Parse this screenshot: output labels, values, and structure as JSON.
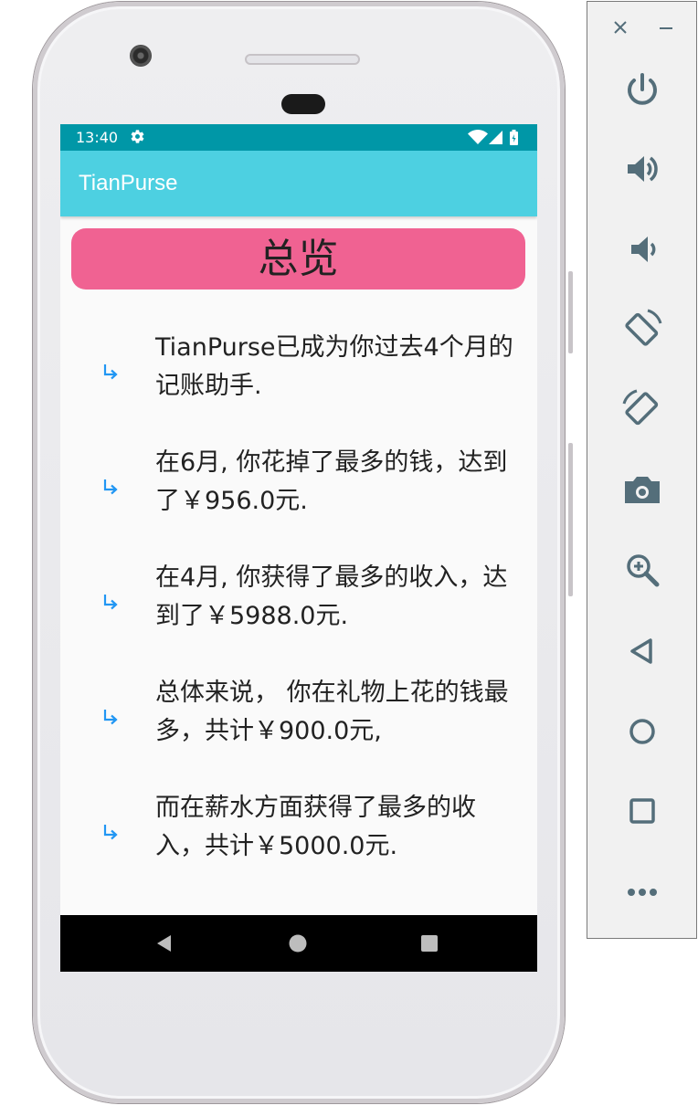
{
  "status_bar": {
    "time": "13:40"
  },
  "app_bar": {
    "title": "TianPurse"
  },
  "header": {
    "title": "总览"
  },
  "items": [
    {
      "text": "TianPurse已成为你过去4个月的记账助手."
    },
    {
      "text": "在6月, 你花掉了最多的钱，达到了￥956.0元."
    },
    {
      "text": "在4月, 你获得了最多的收入，达到了￥5988.0元."
    },
    {
      "text": "总体来说， 你在礼物上花的钱最多，共计￥900.0元,"
    },
    {
      "text": "而在薪水方面获得了最多的收入，共计￥5000.0元."
    }
  ],
  "colors": {
    "status_bar": "#0097a7",
    "app_bar": "#4dd0e1",
    "header_pill": "#f06292",
    "arrow": "#2196f3",
    "toolbar_icon": "#546e7a"
  },
  "icons": {
    "status": [
      "gear-icon",
      "wifi-icon",
      "signal-icon",
      "battery-icon"
    ],
    "list_bullet": "arrow-down-right-icon",
    "nav": [
      "back-icon",
      "home-icon",
      "recents-icon"
    ],
    "toolbar": [
      "close-icon",
      "minimize-icon",
      "power-icon",
      "volume-up-icon",
      "volume-down-icon",
      "rotate-left-icon",
      "rotate-right-icon",
      "camera-icon",
      "zoom-icon",
      "back-icon",
      "home-icon",
      "overview-icon",
      "more-icon"
    ]
  }
}
